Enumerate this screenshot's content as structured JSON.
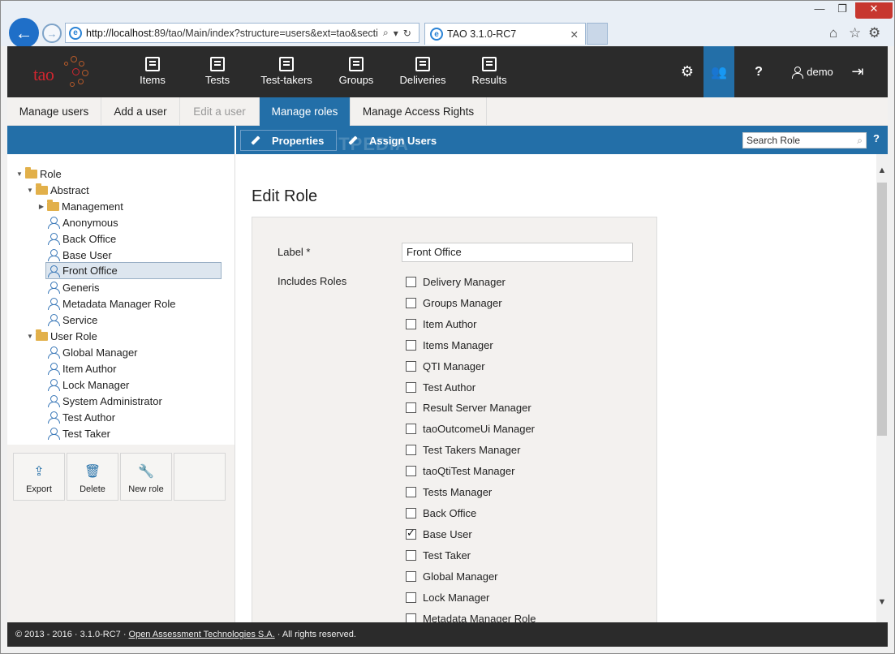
{
  "browser": {
    "address_prefix": "http://localhost",
    "address_rest": ":89/tao/Main/index?structure=users&ext=tao&sectic",
    "tab_title": "TAO 3.1.0-RC7"
  },
  "app": {
    "logo_text": "tao",
    "nav": [
      {
        "label": "Items",
        "icon": "items-icon"
      },
      {
        "label": "Tests",
        "icon": "tests-icon"
      },
      {
        "label": "Test-takers",
        "icon": "test-takers-icon"
      },
      {
        "label": "Groups",
        "icon": "groups-icon"
      },
      {
        "label": "Deliveries",
        "icon": "deliveries-icon"
      },
      {
        "label": "Results",
        "icon": "results-icon"
      }
    ],
    "user_name": "demo"
  },
  "subtabs": [
    {
      "label": "Manage users",
      "state": "normal"
    },
    {
      "label": "Add a user",
      "state": "normal"
    },
    {
      "label": "Edit a user",
      "state": "disabled"
    },
    {
      "label": "Manage roles",
      "state": "active"
    },
    {
      "label": "Manage Access Rights",
      "state": "normal"
    }
  ],
  "toolbar": {
    "properties_label": "Properties",
    "assign_users_label": "Assign Users",
    "search_placeholder": "Search Role",
    "help_label": "?"
  },
  "tree": [
    {
      "label": "Role",
      "type": "folder",
      "level": 0,
      "expanded": true
    },
    {
      "label": "Abstract",
      "type": "folder",
      "level": 1,
      "expanded": true
    },
    {
      "label": "Management",
      "type": "folder",
      "level": 2,
      "expanded": false
    },
    {
      "label": "Anonymous",
      "type": "role",
      "level": 2
    },
    {
      "label": "Back Office",
      "type": "role",
      "level": 2
    },
    {
      "label": "Base User",
      "type": "role",
      "level": 2
    },
    {
      "label": "Front Office",
      "type": "role",
      "level": 2,
      "selected": true
    },
    {
      "label": "Generis",
      "type": "role",
      "level": 2
    },
    {
      "label": "Metadata Manager Role",
      "type": "role",
      "level": 2
    },
    {
      "label": "Service",
      "type": "role",
      "level": 2
    },
    {
      "label": "User Role",
      "type": "folder",
      "level": 1,
      "expanded": true
    },
    {
      "label": "Global Manager",
      "type": "role",
      "level": 2
    },
    {
      "label": "Item Author",
      "type": "role",
      "level": 2
    },
    {
      "label": "Lock Manager",
      "type": "role",
      "level": 2
    },
    {
      "label": "System Administrator",
      "type": "role",
      "level": 2
    },
    {
      "label": "Test Author",
      "type": "role",
      "level": 2
    },
    {
      "label": "Test Taker",
      "type": "role",
      "level": 2
    }
  ],
  "actions": [
    {
      "label": "Export",
      "icon": "export-icon"
    },
    {
      "label": "Delete",
      "icon": "trash-icon"
    },
    {
      "label": "New role",
      "icon": "wrench-icon"
    }
  ],
  "form": {
    "title": "Edit Role",
    "label_caption": "Label *",
    "label_value": "Front Office",
    "includes_caption": "Includes Roles",
    "roles": [
      {
        "label": "Delivery Manager",
        "checked": false
      },
      {
        "label": "Groups Manager",
        "checked": false
      },
      {
        "label": "Item Author",
        "checked": false
      },
      {
        "label": "Items Manager",
        "checked": false
      },
      {
        "label": "QTI Manager",
        "checked": false
      },
      {
        "label": "Test Author",
        "checked": false
      },
      {
        "label": "Result Server Manager",
        "checked": false
      },
      {
        "label": "taoOutcomeUi Manager",
        "checked": false
      },
      {
        "label": "Test Takers Manager",
        "checked": false
      },
      {
        "label": "taoQtiTest Manager",
        "checked": false
      },
      {
        "label": "Tests Manager",
        "checked": false
      },
      {
        "label": "Back Office",
        "checked": false
      },
      {
        "label": "Base User",
        "checked": true
      },
      {
        "label": "Test Taker",
        "checked": false
      },
      {
        "label": "Global Manager",
        "checked": false
      },
      {
        "label": "Lock Manager",
        "checked": false
      },
      {
        "label": "Metadata Manager Role",
        "checked": false
      }
    ]
  },
  "footer": {
    "prefix": "© 2013 - 2016 · 3.1.0-RC7 ·",
    "company": "Open Assessment Technologies S.A.",
    "suffix": "· All rights reserved."
  },
  "colors": {
    "accent": "#236fa8",
    "topbar": "#2b2b2b",
    "logo_red": "#d0262f"
  }
}
